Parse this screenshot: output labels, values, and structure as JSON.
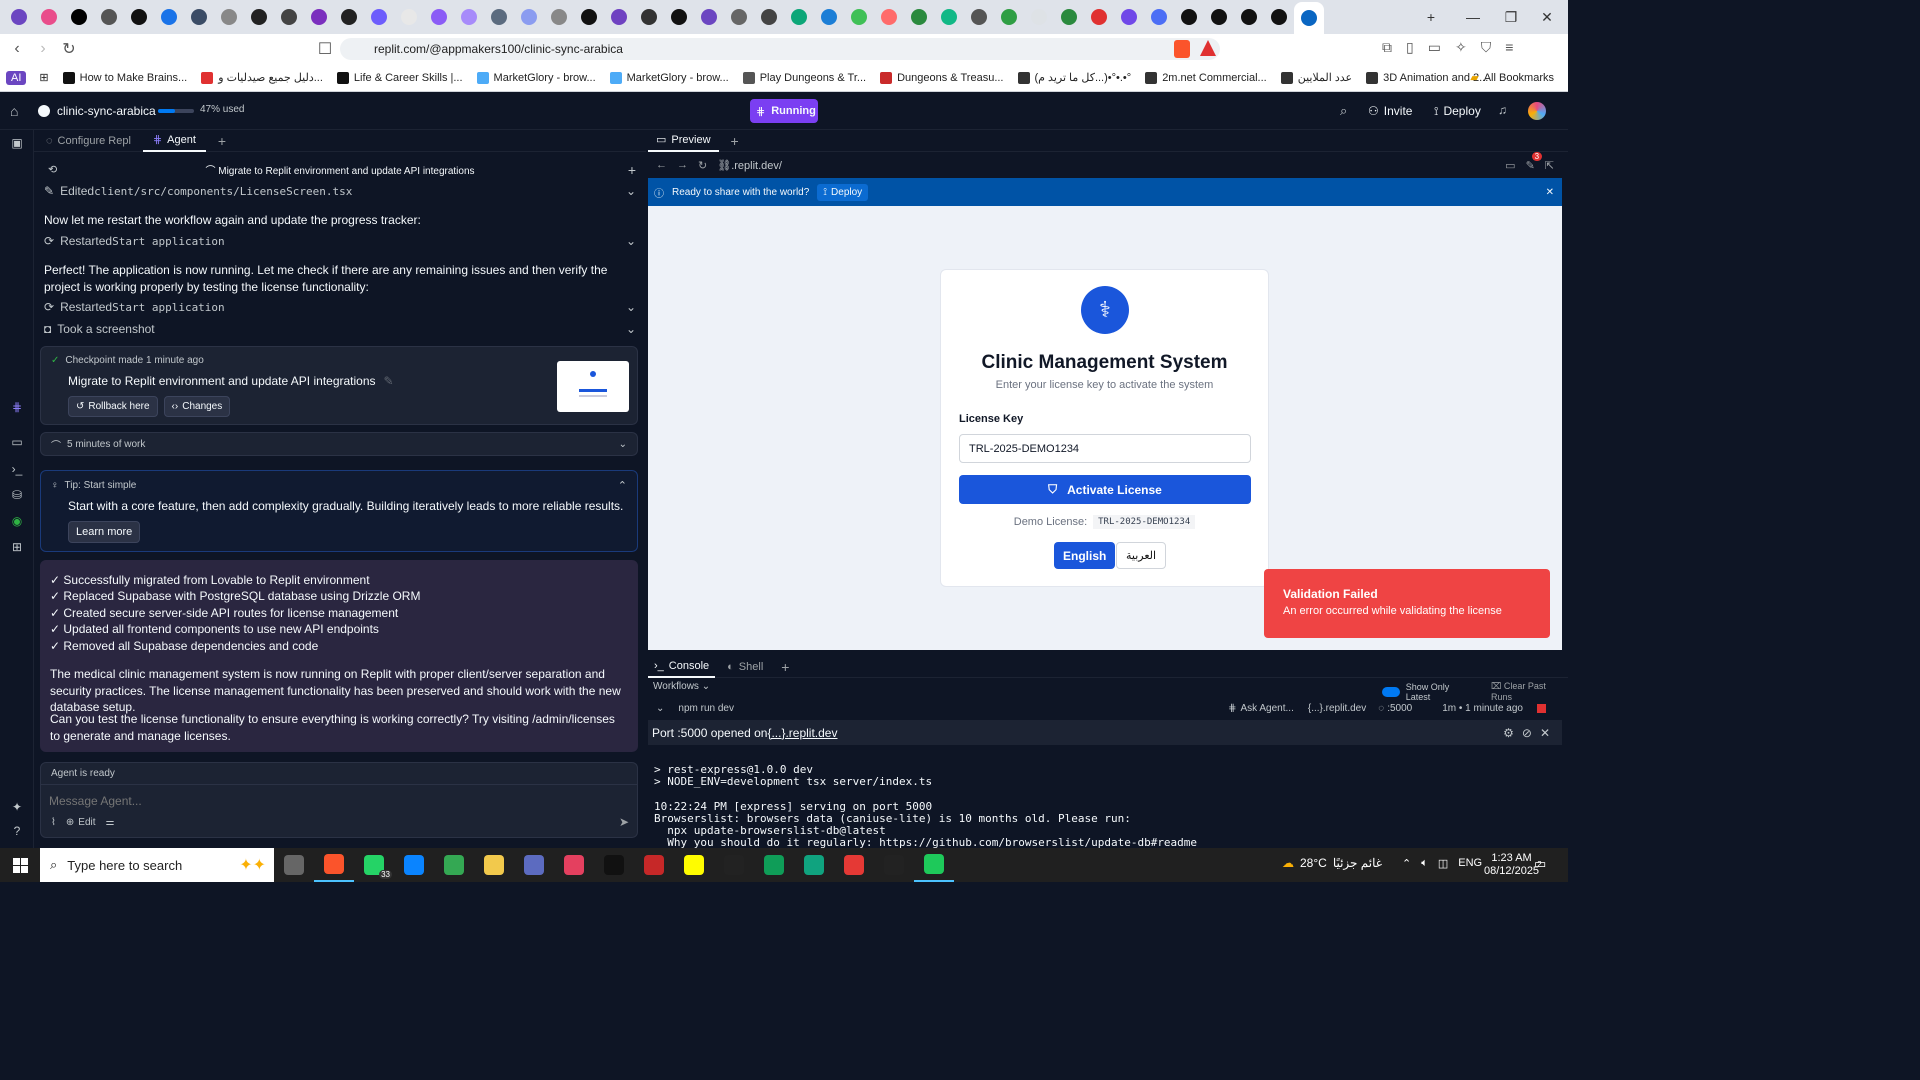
{
  "browser": {
    "url": "replit.com/@appmakers100/clinic-sync-arabica",
    "tab_icons": [
      "#6b46c1",
      "#e94d8b",
      "#000",
      "#555",
      "#111",
      "#1a73e8",
      "#3b4c66",
      "#888",
      "#222",
      "#444",
      "#7b2fbe",
      "#222",
      "#6d5dfc",
      "#e8e8e8",
      "#8b5cf6",
      "#a78bfa",
      "#5b6b7f",
      "#8b9cf0",
      "#888",
      "#111",
      "#6f42c1",
      "#333",
      "#111",
      "#6b46c1",
      "#666",
      "#444",
      "#0ca678",
      "#1c7ed6",
      "#40c057",
      "#ff6b6b",
      "#2b8a3e",
      "#12b886",
      "#555",
      "#2f9e44",
      "#dee2e6",
      "#2b8a3e",
      "#e03131",
      "#7048e8",
      "#4c6ef5",
      "#111",
      "#111",
      "#111",
      "#111",
      "#0a66c2"
    ],
    "bookmarks": [
      {
        "label": "AI",
        "color": "#6b46c1"
      },
      {
        "label": "How to Make Brains...",
        "color": "#111"
      },
      {
        "label": "دليل جميع صيدليات و...",
        "color": "#e03131"
      },
      {
        "label": "Life & Career Skills |...",
        "color": "#111"
      },
      {
        "label": "MarketGlory - brow...",
        "color": "#4dabf7"
      },
      {
        "label": "MarketGlory - brow...",
        "color": "#4dabf7"
      },
      {
        "label": "Play Dungeons & Tr...",
        "color": "#555"
      },
      {
        "label": "Dungeons & Treasu...",
        "color": "#c92a2a"
      },
      {
        "label": "(كل ما تريد م...)•°•.•°",
        "color": "#333"
      },
      {
        "label": "2m.net Commercial...",
        "color": "#333"
      },
      {
        "label": "عدد الملايين",
        "color": "#333"
      },
      {
        "label": "3D Animation and 2...",
        "color": "#333"
      }
    ],
    "all_bookmarks": "All Bookmarks"
  },
  "repl": {
    "name": "clinic-sync-arabica",
    "usage": "47% used",
    "usage_fraction": 0.47,
    "status": "Running",
    "invite": "Invite",
    "deploy": "Deploy"
  },
  "agent": {
    "tabs": [
      "Configure Repl",
      "Agent"
    ],
    "thread_title": "Migrate to Replit environment and update API integrations",
    "edited": "Edited ",
    "edited_file": "client/src/components/LicenseScreen.tsx",
    "msg1": "Now let me restart the workflow again and update the progress tracker:",
    "restarted_label": "Restarted ",
    "restarted_cmd": "Start application",
    "msg2": "Perfect! The application is now running. Let me check if there are any remaining issues and then verify the project is working properly by testing the license functionality:",
    "screenshot": "Took a screenshot",
    "checkpoint_time": "Checkpoint made 1 minute ago",
    "checkpoint_title": "Migrate to Replit environment and update API integrations",
    "rollback": "Rollback here",
    "changes": "Changes",
    "work": "5 minutes of work",
    "tip_title": "Tip: Start simple",
    "tip_body": "Start with a core feature, then add complexity gradually. Building iteratively leads to more reliable results.",
    "learn_more": "Learn more",
    "summary": [
      "✓ Successfully migrated from Lovable to Replit environment",
      "✓ Replaced Supabase with PostgreSQL database using Drizzle ORM",
      "✓ Created secure server-side API routes for license management",
      "✓ Updated all frontend components to use new API endpoints",
      "✓ Removed all Supabase dependencies and code"
    ],
    "para1": "The medical clinic management system is now running on Replit with proper client/server separation and security practices. The license management functionality has been preserved and should work with the new database setup.",
    "para2": "Can you test the license functionality to ensure everything is working correctly? Try visiting /admin/licenses to generate and manage licenses.",
    "status": "Agent is ready",
    "placeholder": "Message Agent...",
    "edit": "Edit"
  },
  "preview": {
    "tab": "Preview",
    "url": ".replit.dev/",
    "banner": "Ready to share with the world?",
    "banner_deploy": "Deploy",
    "badge": "3",
    "app": {
      "title": "Clinic Management System",
      "subtitle": "Enter your license key to activate the system",
      "label": "License Key",
      "value": "TRL-2025-DEMO1234",
      "activate": "Activate License",
      "demo_label": "Demo License:",
      "demo_value": "TRL-2025-DEMO1234",
      "lang_en": "English",
      "lang_ar": "العربية"
    },
    "toast": {
      "title": "Validation Failed",
      "body": "An error occurred while validating the license"
    }
  },
  "console": {
    "tabs": [
      "Console",
      "Shell"
    ],
    "workflows": "Workflows",
    "show_latest": "Show Only Latest",
    "clear": "Clear Past Runs",
    "cmd": "npm run dev",
    "ask": "Ask Agent...",
    "domain": "{...}.replit.dev",
    "port": ":5000",
    "time": "1m • 1 minute ago",
    "port_msg": "Port :5000 opened on ",
    "port_link": "{...}.replit.dev",
    "lines": [
      "> rest-express@1.0.0 dev",
      "> NODE_ENV=development tsx server/index.ts",
      "",
      "10:22:24 PM [express] serving on port 5000",
      "Browserslist: browsers data (caniuse-lite) is 10 months old. Please run:",
      "  npx update-browserslist-db@latest",
      "  Why you should do it regularly: https://github.com/browserslist/update-db#readme"
    ]
  },
  "taskbar": {
    "search": "Type here to search",
    "weather": "28°C",
    "weather_desc": "غائم جزئيًا",
    "lang": "ENG",
    "time": "1:23 AM",
    "date": "08/12/2025",
    "whatsapp_badge": "33",
    "notif": "2"
  }
}
